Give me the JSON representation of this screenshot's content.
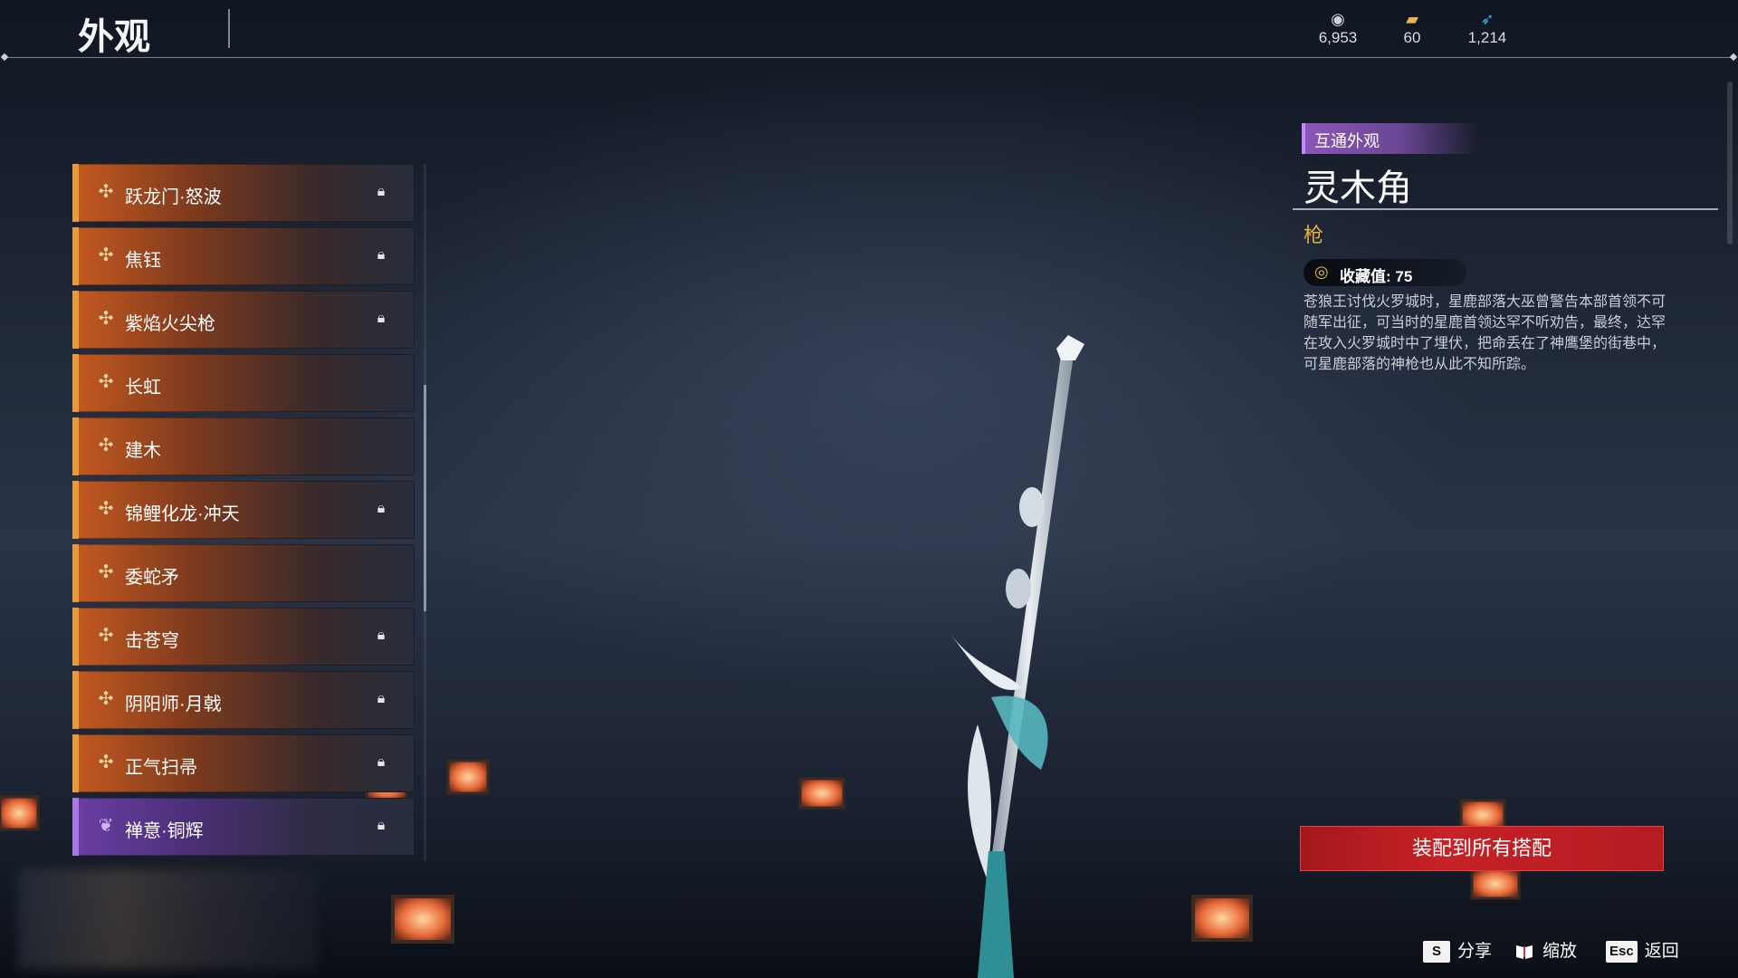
{
  "header": {
    "title": "外观",
    "currencies": [
      {
        "icon": "silver-coin-icon",
        "value": "6,953",
        "color": "#c9d1d9"
      },
      {
        "icon": "gold-ticket-icon",
        "value": "60",
        "color": "#e7b94a"
      },
      {
        "icon": "feather-icon",
        "value": "1,214",
        "color": "#37b8d6"
      }
    ]
  },
  "list": {
    "items": [
      {
        "name": "跃龙门·怒波",
        "locked": true,
        "rarity": "orange"
      },
      {
        "name": "焦钰",
        "locked": true,
        "rarity": "orange"
      },
      {
        "name": "紫焰火尖枪",
        "locked": true,
        "rarity": "orange"
      },
      {
        "name": "长虹",
        "locked": false,
        "rarity": "orange"
      },
      {
        "name": "建木",
        "locked": false,
        "rarity": "orange"
      },
      {
        "name": "锦鲤化龙·冲天",
        "locked": true,
        "rarity": "orange"
      },
      {
        "name": "委蛇矛",
        "locked": false,
        "rarity": "orange"
      },
      {
        "name": "击苍穹",
        "locked": true,
        "rarity": "orange"
      },
      {
        "name": "阴阳师·月戟",
        "locked": true,
        "rarity": "orange"
      },
      {
        "name": "正气扫帚",
        "locked": true,
        "rarity": "orange"
      },
      {
        "name": "禅意·铜辉",
        "locked": true,
        "rarity": "purple"
      }
    ]
  },
  "detail": {
    "tag": "互通外观",
    "title": "灵木角",
    "type": "枪",
    "collect_label": "收藏值: 75",
    "description": "苍狼王讨伐火罗城时，星鹿部落大巫曾警告本部首领不可随军出征，可当时的星鹿首领达罕不听劝告，最终，达罕在攻入火罗城时中了埋伏，把命丢在了神鹰堡的街巷中，可星鹿部落的神枪也从此不知所踪。"
  },
  "actions": {
    "equip_all": "装配到所有搭配"
  },
  "hints": [
    {
      "key": "S",
      "label": "分享"
    },
    {
      "key": "book-icon",
      "label": "缩放"
    },
    {
      "key": "Esc",
      "label": "返回"
    }
  ],
  "colors": {
    "accent_gold": "#e5b13f",
    "button_red": "#c62227",
    "rarity_orange": "#e89b3a",
    "rarity_purple": "#a877e6"
  }
}
